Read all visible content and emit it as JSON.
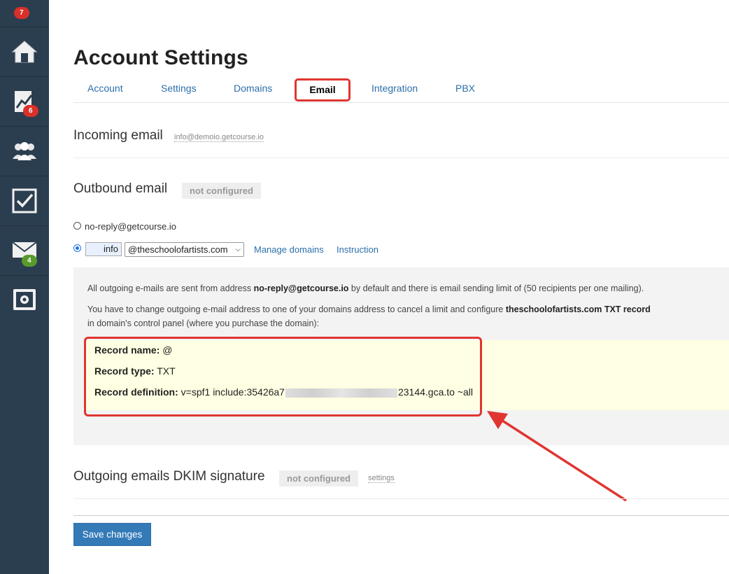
{
  "sidebar": {
    "top_badge": "7",
    "items": [
      {
        "icon": "home-icon",
        "badge": ""
      },
      {
        "icon": "chart-icon",
        "badge": "6"
      },
      {
        "icon": "users-icon",
        "badge": ""
      },
      {
        "icon": "checkbox-icon",
        "badge": ""
      },
      {
        "icon": "mail-icon",
        "badge": "4"
      },
      {
        "icon": "safe-icon",
        "badge": ""
      }
    ]
  },
  "page": {
    "title": "Account Settings",
    "tabs": [
      "Account",
      "Settings",
      "Domains",
      "Email",
      "Integration",
      "PBX"
    ],
    "active_tab": "Email"
  },
  "incoming": {
    "title": "Incoming email",
    "address": "info@demoio.getcourse.io"
  },
  "outbound": {
    "title": "Outbound email",
    "status": "not configured",
    "option_default": "no-reply@getcourse.io",
    "local_part": "info",
    "domain": "@theschoolofartists.com",
    "manage_domains": "Manage domains",
    "instruction": "Instruction"
  },
  "info": {
    "line1_a": "All outgoing e-mails are sent from address ",
    "line1_b": "no-reply@getcourse.io",
    "line1_c": " by default and there is email sending limit of (50 recipients per one mailing).",
    "line2_a": "You have to change outgoing e-mail address to one of your domains address to cancel a limit   and configure ",
    "line2_b": "theschoolofartists.com TXT record",
    "line3": "in domain's control panel (where you purchase the domain):"
  },
  "record": {
    "name_label": "Record name:",
    "name_value": "@",
    "type_label": "Record type:",
    "type_value": "TXT",
    "def_label": "Record definition:",
    "def_value_start": "v=spf1 include:35426a7",
    "def_value_end": "23144.gca.to ~all"
  },
  "dkim": {
    "title": "Outgoing emails DKIM signature",
    "status": "not configured",
    "settings": "settings"
  },
  "save_label": "Save changes",
  "colors": {
    "sidebar": "#2b3e50",
    "link": "#2c6fab",
    "highlight": "#e03530",
    "button": "#337ab7"
  }
}
